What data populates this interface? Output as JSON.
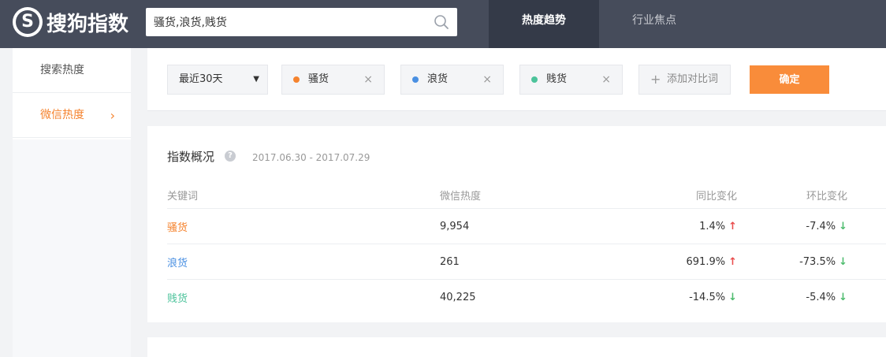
{
  "header": {
    "logo_glyph": "S",
    "logo_text": "搜狗指数",
    "search_value": "骚货,浪货,贱货",
    "tabs": [
      {
        "label": "热度趋势",
        "active": true
      },
      {
        "label": "行业焦点",
        "active": false
      }
    ]
  },
  "sidebar": {
    "items": [
      {
        "label": "搜索热度",
        "active": false
      },
      {
        "label": "微信热度",
        "active": true,
        "arrow": "›"
      }
    ]
  },
  "keywords": {
    "range_label": "最近30天",
    "chips": [
      {
        "label": "骚货",
        "color": "#f5832e"
      },
      {
        "label": "浪货",
        "color": "#4a90e2"
      },
      {
        "label": "贱货",
        "color": "#4cc39b"
      }
    ],
    "close_glyph": "×",
    "add_label": "添加对比词",
    "confirm_label": "确定"
  },
  "overview": {
    "title": "指数概况",
    "help_glyph": "?",
    "date_range": "2017.06.30 - 2017.07.29",
    "columns": [
      "关键词",
      "微信热度",
      "同比变化",
      "环比变化"
    ],
    "rows": [
      {
        "keyword": "骚货",
        "color": "#f5832e",
        "heat": "9,954",
        "yoy": "1.4%",
        "yoy_dir": "up",
        "mom": "-7.4%",
        "mom_dir": "down"
      },
      {
        "keyword": "浪货",
        "color": "#4a90e2",
        "heat": "261",
        "yoy": "691.9%",
        "yoy_dir": "up",
        "mom": "-73.5%",
        "mom_dir": "down"
      },
      {
        "keyword": "贱货",
        "color": "#4cc39b",
        "heat": "40,225",
        "yoy": "-14.5%",
        "yoy_dir": "down",
        "mom": "-5.4%",
        "mom_dir": "down"
      }
    ]
  }
}
